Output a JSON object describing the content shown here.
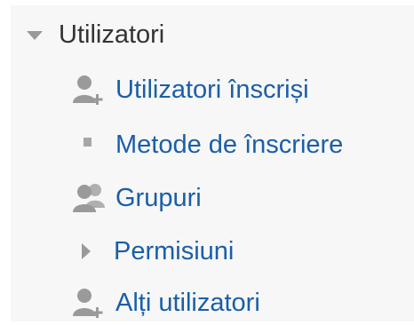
{
  "menu": {
    "header": {
      "label": "Utilizatori",
      "icon": "caret-down-icon"
    },
    "items": [
      {
        "label": "Utilizatori înscriși",
        "icon": "user-add-icon"
      },
      {
        "label": "Metode de înscriere",
        "icon": "bullet-icon"
      },
      {
        "label": "Grupuri",
        "icon": "users-group-icon"
      },
      {
        "label": "Permisiuni",
        "icon": "caret-right-icon"
      },
      {
        "label": "Alți utilizatori",
        "icon": "user-add-icon"
      }
    ]
  },
  "colors": {
    "link": "#1a5ea8",
    "header_text": "#333333",
    "icon": "#9a9a9a",
    "panel_bg": "#f7f7f7"
  }
}
